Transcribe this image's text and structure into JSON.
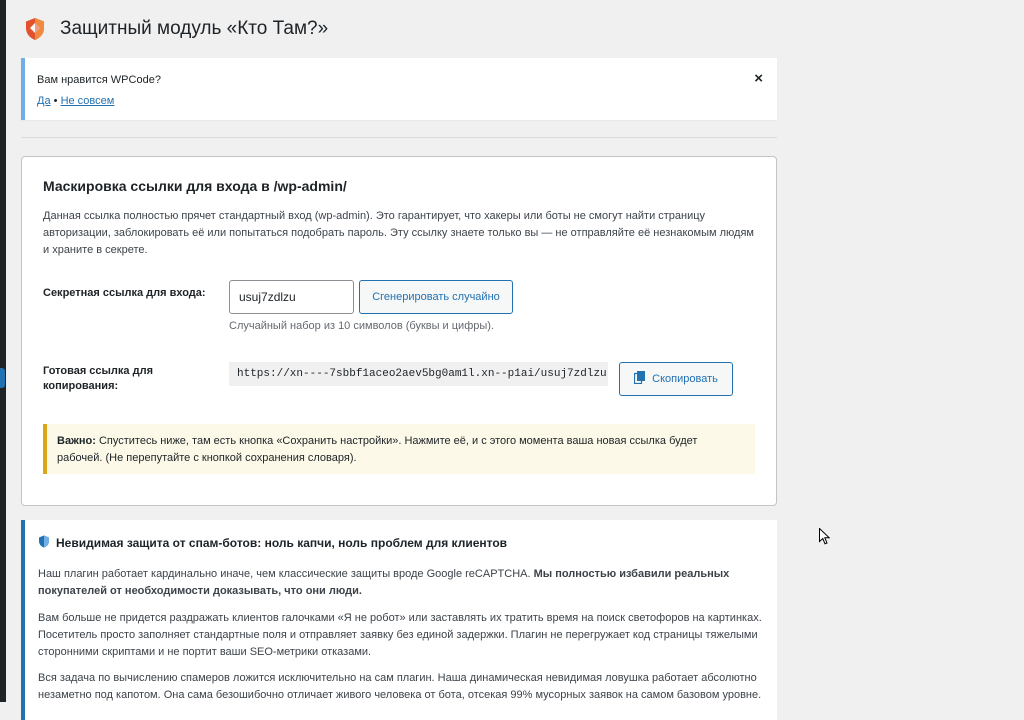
{
  "page": {
    "title": "Защитный модуль «Кто Там?»"
  },
  "notice": {
    "question": "Вам нравится WPCode?",
    "yes_label": "Да",
    "separator": "•",
    "no_label": "Не совсем",
    "close_label": "×"
  },
  "masking": {
    "title": "Маскировка ссылки для входа в /wp-admin/",
    "description": "Данная ссылка полностью прячет стандартный вход (wp-admin). Это гарантирует, что хакеры или боты не смогут найти страницу авторизации, заблокировать её или попытаться подобрать пароль. Эту ссылку знаете только вы — не отправляйте её незнакомым людям и храните в секрете.",
    "secret_label": "Секретная ссылка для входа:",
    "secret_value": "usuj7zdlzu",
    "generate_label": "Сгенерировать случайно",
    "hint": "Случайный набор из 10 символов (буквы и цифры).",
    "ready_label": "Готовая ссылка для копирования:",
    "ready_url": "https://xn----7sbbf1aceo2aev5bg0am1l.xn--p1ai/usuj7zdlzu",
    "copy_label": "Скопировать",
    "warning_strong": "Важно:",
    "warning_text": " Спуститесь ниже, там есть кнопка «Сохранить настройки». Нажмите её, и с этого момента ваша новая ссылка будет рабочей. (Не перепутайте с кнопкой сохранения словаря)."
  },
  "spam": {
    "title": "Невидимая защита от спам-ботов: ноль капчи, ноль проблем для клиентов",
    "p1_text": "Наш плагин работает кардинально иначе, чем классические защиты вроде Google reCAPTCHA. ",
    "p1_strong": "Мы полностью избавили реальных покупателей от необходимости доказывать, что они люди.",
    "p2": "Вам больше не придется раздражать клиентов галочками «Я не робот» или заставлять их тратить время на поиск светофоров на картинках. Посетитель просто заполняет стандартные поля и отправляет заявку без единой задержки. Плагин не перегружает код страницы тяжелыми сторонними скриптами и не портит ваши SEO-метрики отказами.",
    "p3": "Вся задача по вычислению спамеров ложится исключительно на сам плагин. Наша динамическая невидимая ловушка работает абсолютно незаметно под капотом. Она сама безошибочно отличает живого человека от бота, отсекая 99% мусорных заявок на самом базовом уровне."
  },
  "colors": {
    "accent": "#2271b1",
    "shield_orange": "#e2522e",
    "warning_border": "#dba617"
  },
  "icons": {
    "logo": "shield-icon",
    "copy": "copy-icon",
    "spam_title": "shield-icon"
  }
}
